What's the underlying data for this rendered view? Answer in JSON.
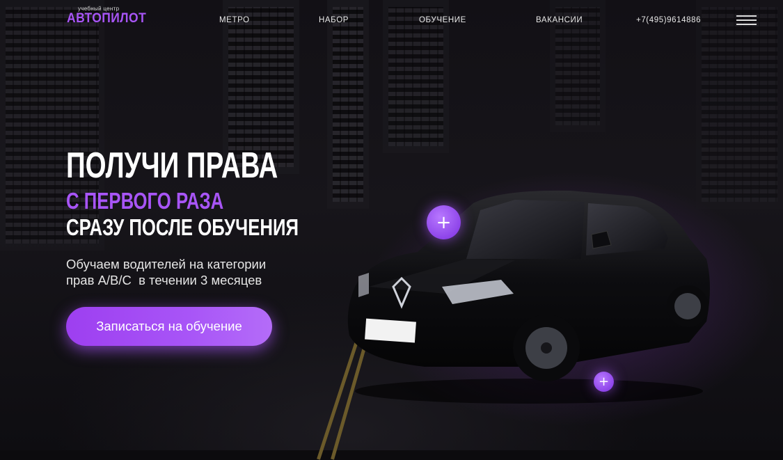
{
  "brand": {
    "tagline": "учебный центр",
    "name": "АВТОПИЛОТ",
    "accent_color": "#a855f7"
  },
  "nav": {
    "items": [
      {
        "label": "МЕТРО"
      },
      {
        "label": "НАБОР"
      },
      {
        "label": "ОБУЧЕНИЕ"
      },
      {
        "label": "ВАКАНСИИ"
      }
    ],
    "phone": "+7(495)9614886",
    "menu_icon": "hamburger-icon"
  },
  "hero": {
    "title": "ПОЛУЧИ ПРАВА",
    "subtitle_accent": "С ПЕРВОГО РАЗА",
    "subtitle": "СРАЗУ ПОСЛЕ ОБУЧЕНИЯ",
    "description_line1": "Обучаем водителей на категории",
    "description_line2": "прав А/В/С  в течении 3 месяцев",
    "cta_label": "Записаться на обучение"
  },
  "hotspots": [
    {
      "icon": "plus-icon",
      "glyph": "+"
    },
    {
      "icon": "plus-icon",
      "glyph": "+"
    }
  ]
}
